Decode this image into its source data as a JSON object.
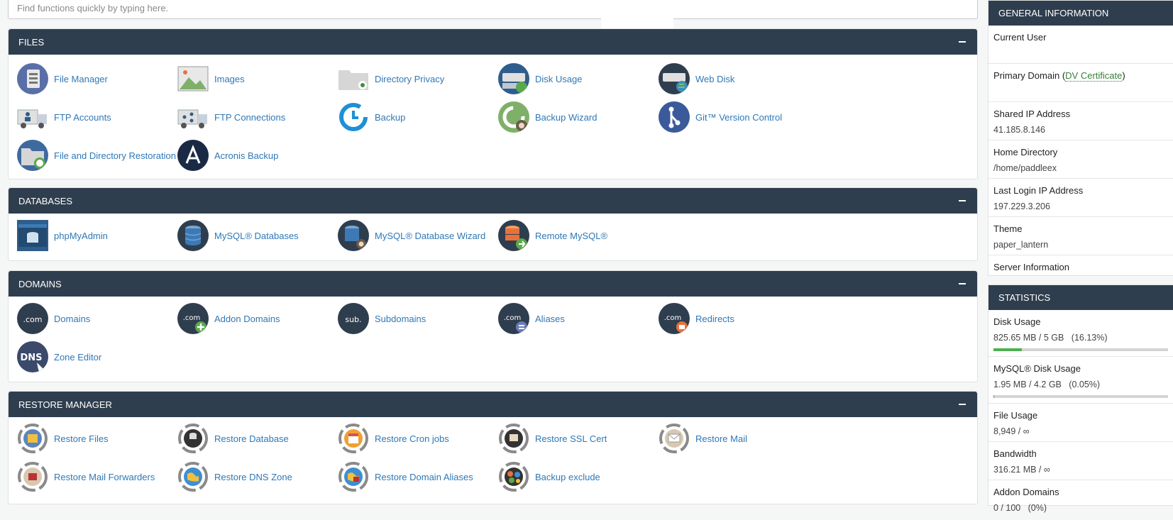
{
  "search": {
    "placeholder": "Find functions quickly by typing here."
  },
  "sections": {
    "files": {
      "title": "FILES",
      "items": [
        {
          "label": "File Manager",
          "icon": "file-manager-icon"
        },
        {
          "label": "Images",
          "icon": "images-icon"
        },
        {
          "label": "Directory Privacy",
          "icon": "directory-privacy-icon"
        },
        {
          "label": "Disk Usage",
          "icon": "disk-usage-icon"
        },
        {
          "label": "Web Disk",
          "icon": "web-disk-icon"
        },
        {
          "label": "FTP Accounts",
          "icon": "ftp-accounts-icon"
        },
        {
          "label": "FTP Connections",
          "icon": "ftp-connections-icon"
        },
        {
          "label": "Backup",
          "icon": "backup-icon"
        },
        {
          "label": "Backup Wizard",
          "icon": "backup-wizard-icon"
        },
        {
          "label": "Git™ Version Control",
          "icon": "git-icon"
        },
        {
          "label": "File and Directory Restoration",
          "icon": "restoration-icon"
        },
        {
          "label": "Acronis Backup",
          "icon": "acronis-icon"
        }
      ]
    },
    "databases": {
      "title": "DATABASES",
      "items": [
        {
          "label": "phpMyAdmin",
          "icon": "phpmyadmin-icon"
        },
        {
          "label": "MySQL® Databases",
          "icon": "mysql-databases-icon"
        },
        {
          "label": "MySQL® Database Wizard",
          "icon": "mysql-wizard-icon"
        },
        {
          "label": "Remote MySQL®",
          "icon": "remote-mysql-icon"
        }
      ]
    },
    "domains": {
      "title": "DOMAINS",
      "items": [
        {
          "label": "Domains",
          "icon": "domains-icon",
          "badge": ".com"
        },
        {
          "label": "Addon Domains",
          "icon": "addon-domains-icon",
          "badge": ".com"
        },
        {
          "label": "Subdomains",
          "icon": "subdomains-icon",
          "badge": "sub."
        },
        {
          "label": "Aliases",
          "icon": "aliases-icon",
          "badge": ".com"
        },
        {
          "label": "Redirects",
          "icon": "redirects-icon",
          "badge": ".com"
        },
        {
          "label": "Zone Editor",
          "icon": "zone-editor-icon",
          "badge": "DNS"
        }
      ]
    },
    "restore": {
      "title": "RESTORE MANAGER",
      "items": [
        {
          "label": "Restore Files",
          "icon": "restore-files-icon"
        },
        {
          "label": "Restore Database",
          "icon": "restore-database-icon"
        },
        {
          "label": "Restore Cron jobs",
          "icon": "restore-cron-icon"
        },
        {
          "label": "Restore SSL Cert",
          "icon": "restore-ssl-icon"
        },
        {
          "label": "Restore Mail",
          "icon": "restore-mail-icon"
        },
        {
          "label": "Restore Mail Forwarders",
          "icon": "restore-mail-forwarders-icon"
        },
        {
          "label": "Restore DNS Zone",
          "icon": "restore-dns-icon"
        },
        {
          "label": "Restore Domain Aliases",
          "icon": "restore-domain-aliases-icon"
        },
        {
          "label": "Backup exclude",
          "icon": "backup-exclude-icon"
        }
      ]
    }
  },
  "general": {
    "title": "GENERAL INFORMATION",
    "current_user_label": "Current User",
    "primary_domain_label": "Primary Domain",
    "dv_open": "(",
    "dv_text": "DV Certificate",
    "dv_close": ")",
    "shared_ip_label": "Shared IP Address",
    "shared_ip": "41.185.8.146",
    "home_dir_label": "Home Directory",
    "home_dir": "/home/paddleex",
    "last_login_label": "Last Login IP Address",
    "last_login": "197.229.3.206",
    "theme_label": "Theme",
    "theme": "paper_lantern",
    "server_info": "Server Information"
  },
  "statistics": {
    "title": "STATISTICS",
    "disk_usage_label": "Disk Usage",
    "disk_usage_value": "825.65 MB / 5 GB   (16.13%)",
    "disk_usage_fraction": 0.1613,
    "mysql_label": "MySQL® Disk Usage",
    "mysql_value": "1.95 MB / 4.2 GB   (0.05%)",
    "mysql_fraction": 0.0005,
    "file_usage_label": "File Usage",
    "file_usage_value": "8,949 / ∞",
    "bandwidth_label": "Bandwidth",
    "bandwidth_value": "316.21 MB / ∞",
    "addon_label": "Addon Domains",
    "addon_value": "0 / 100   (0%)"
  },
  "colors": {
    "header": "#2f3e4e",
    "link": "#2f78b6",
    "progress": "#4caf50"
  }
}
